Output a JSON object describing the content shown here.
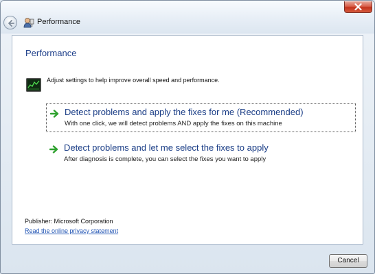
{
  "window": {
    "title": "Performance"
  },
  "content": {
    "heading": "Performance",
    "intro": "Adjust settings to help improve overall speed and performance.",
    "options": [
      {
        "title": "Detect problems and apply the fixes for me (Recommended)",
        "description": "With one click, we will detect problems AND apply the fixes on this machine"
      },
      {
        "title": "Detect problems and let me select the fixes to apply",
        "description": "After diagnosis is complete, you can select the fixes you want to apply"
      }
    ],
    "publisher": "Publisher: Microsoft Corporation",
    "privacy_link": "Read the online privacy statement"
  },
  "footer": {
    "cancel_label": "Cancel"
  },
  "icons": {
    "back": "back-arrow-icon",
    "app": "troubleshooter-icon",
    "close": "close-icon",
    "performance": "performance-monitor-icon",
    "option_arrow": "green-arrow-icon"
  },
  "colors": {
    "heading": "#1e3f8a",
    "link": "#2255b4",
    "arrow": "#2ea12e",
    "close_button": "#c3331c"
  }
}
